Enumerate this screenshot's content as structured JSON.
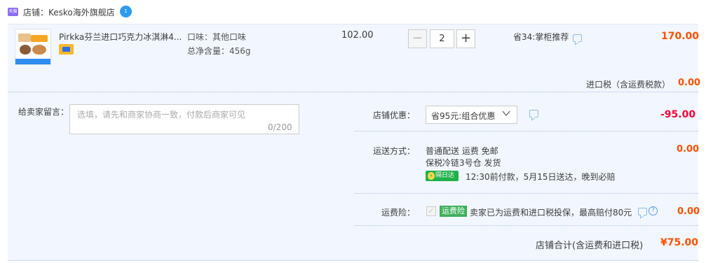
{
  "shop": {
    "logo_text": "天猫",
    "label": "店铺：Kesko海外旗舰店",
    "ww_icon_text": "1"
  },
  "item": {
    "title": "Pirkka芬兰进口巧克力冰淇淋4...",
    "attr_flavor": "口味：其他口味",
    "attr_weight": "总净含量：456g",
    "unit_price": "102.00",
    "quantity": "2",
    "minus_symbol": "−",
    "plus_symbol": "+",
    "promo": "省34:掌柜推荐",
    "total": "170.00"
  },
  "tax": {
    "label": "进口税（含运费税款）",
    "value": "0.00"
  },
  "message": {
    "label": "给卖家留言：",
    "placeholder": "选填，请先和商家协商一致，付款后商家可见",
    "count": "0/200"
  },
  "discount": {
    "label": "店铺优惠：",
    "selected": "省95元:组合优惠",
    "value": "-95.00"
  },
  "shipping": {
    "label": "运送方式：",
    "line1": "普通配送 运费 免邮",
    "line2": "保税冷链3号仓  发货",
    "badge": "隔日达",
    "badge_icon": "⚡",
    "line3": "12:30前付款，5月15日送达，晚到必赔",
    "value": "0.00"
  },
  "insurance": {
    "label": "运费险：",
    "check_mark": "✓",
    "tag": "运费险",
    "text": "卖家已为运费和进口税投保，最高赔付80元",
    "help_symbol": "?",
    "value": "0.00"
  },
  "total": {
    "label": "店铺合计(含运费和进口税)",
    "value": "¥75.00"
  },
  "colors": {
    "price_orange": "#ff5000",
    "discount_red": "#ff0036",
    "panel_bg": "#f2f7ff",
    "badge_green": "#21b14b"
  }
}
